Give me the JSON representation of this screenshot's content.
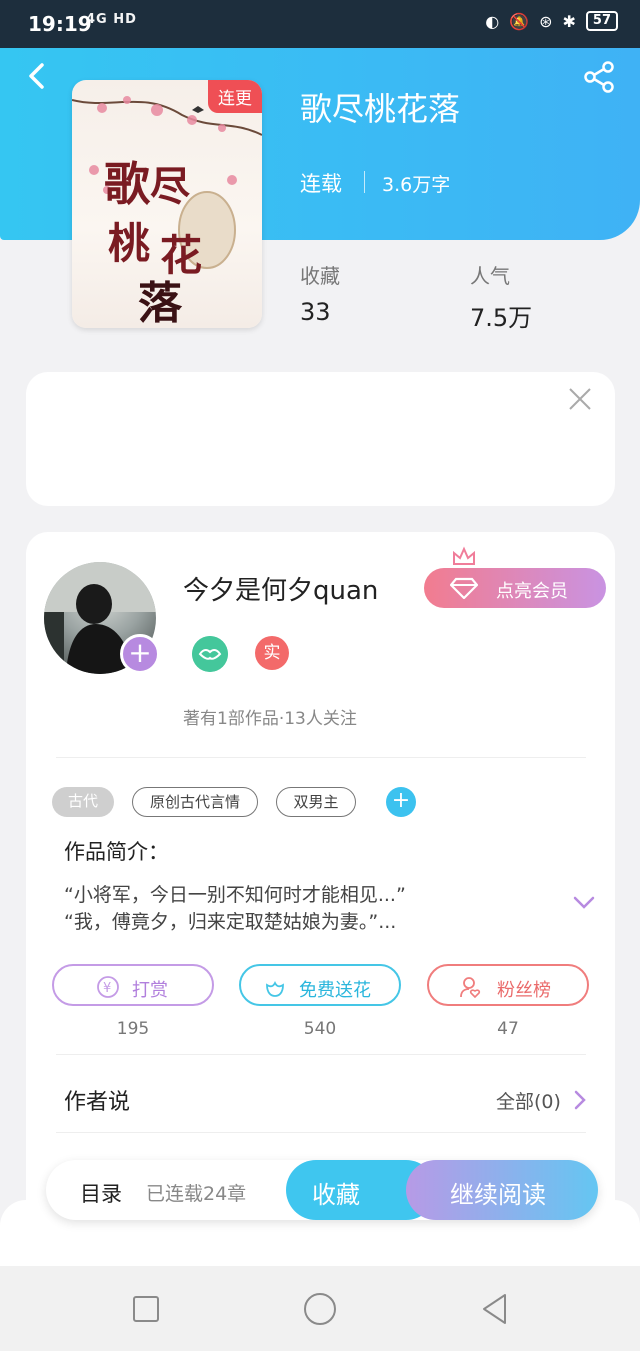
{
  "status_bar": {
    "time": "19:19",
    "network": "4G HD",
    "battery": "57"
  },
  "book": {
    "title": "歌尽桃花落",
    "cover_tag": "连更",
    "status": "连载",
    "words": "3.6万字",
    "stats": [
      {
        "label": "收藏",
        "value": "33"
      },
      {
        "label": "人气",
        "value": "7.5万"
      }
    ]
  },
  "author": {
    "name": "今夕是何夕quan",
    "vip_label": "点亮会员",
    "badge_real": "实",
    "meta": "著有1部作品·13人关注"
  },
  "tags": [
    "古代",
    "原创古代言情",
    "双男主"
  ],
  "intro": {
    "title": "作品简介：",
    "line1": "“小将军，今日一别不知何时才能相见...”",
    "line2": "“我，傅竟夕，归来定取楚姑娘为妻。”..."
  },
  "actions": [
    {
      "label": "打赏",
      "count": "195"
    },
    {
      "label": "免费送花",
      "count": "540"
    },
    {
      "label": "粉丝榜",
      "count": "47"
    }
  ],
  "author_says": {
    "title": "作者说",
    "all": "全部(0)"
  },
  "bottom_bar": {
    "toc": "目录",
    "toc_count": "已连载24章",
    "collect": "收藏",
    "read": "继续阅读"
  },
  "colors": {
    "header": "#3fb2f5",
    "accent_purple": "#c49be6",
    "accent_cyan": "#45c6e6",
    "accent_red": "#f07d7d"
  }
}
